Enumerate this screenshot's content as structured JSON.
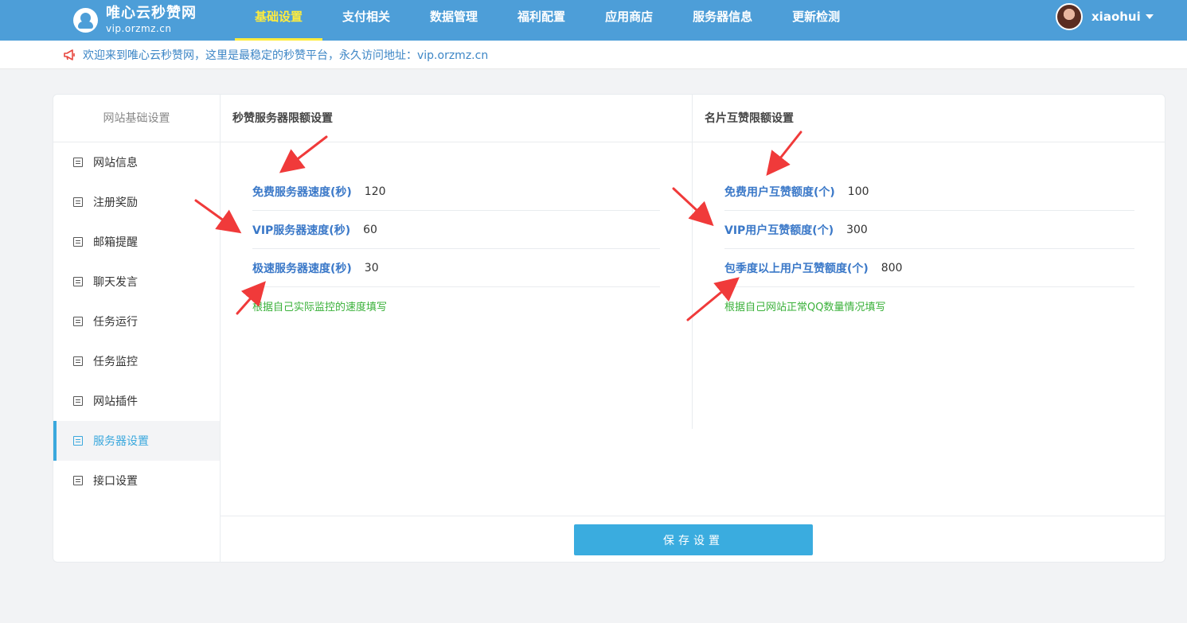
{
  "brand": {
    "title": "唯心云秒赞网",
    "subtitle": "vip.orzmz.cn"
  },
  "nav": {
    "items": [
      {
        "label": "基础设置",
        "active": true
      },
      {
        "label": "支付相关"
      },
      {
        "label": "数据管理"
      },
      {
        "label": "福利配置"
      },
      {
        "label": "应用商店"
      },
      {
        "label": "服务器信息"
      },
      {
        "label": "更新检测"
      }
    ]
  },
  "user": {
    "name": "xiaohui"
  },
  "notice": {
    "text": "欢迎来到唯心云秒赞网，这里是最稳定的秒赞平台，永久访问地址：vip.orzmz.cn"
  },
  "sidebar": {
    "title": "网站基础设置",
    "items": [
      {
        "label": "网站信息"
      },
      {
        "label": "注册奖励"
      },
      {
        "label": "邮箱提醒"
      },
      {
        "label": "聊天发言"
      },
      {
        "label": "任务运行"
      },
      {
        "label": "任务监控"
      },
      {
        "label": "网站插件"
      },
      {
        "label": "服务器设置",
        "active": true
      },
      {
        "label": "接口设置"
      }
    ]
  },
  "server_limits": {
    "title": "秒赞服务器限额设置",
    "fields": [
      {
        "label": "免费服务器速度(秒)",
        "value": "120"
      },
      {
        "label": "VIP服务器速度(秒)",
        "value": "60"
      },
      {
        "label": "极速服务器速度(秒)",
        "value": "30"
      }
    ],
    "hint": "根据自己实际监控的速度填写"
  },
  "card_limits": {
    "title": "名片互赞限额设置",
    "fields": [
      {
        "label": "免费用户互赞额度(个)",
        "value": "100"
      },
      {
        "label": "VIP用户互赞额度(个)",
        "value": "300"
      },
      {
        "label": "包季度以上用户互赞额度(个)",
        "value": "800"
      }
    ],
    "hint": "根据自己网站正常QQ数量情况填写"
  },
  "save_button": {
    "label": "保存设置"
  },
  "colors": {
    "topbar": "#4d9ed8",
    "nav_active": "#ffec3d",
    "label_blue": "#3a78c8",
    "hint_green": "#3ab13a",
    "button": "#3aacdf",
    "arrow_red": "#f03a3a"
  }
}
